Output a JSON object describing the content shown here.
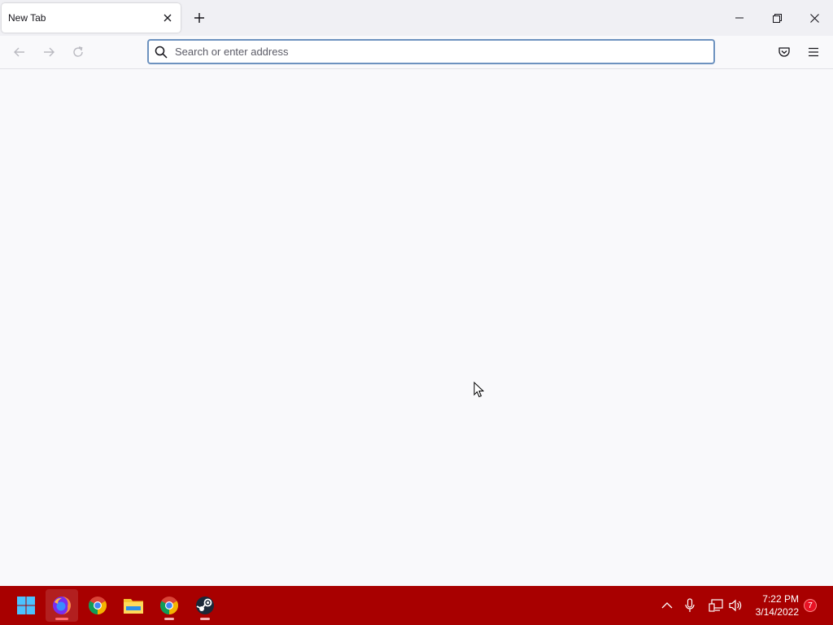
{
  "browser": {
    "tab": {
      "title": "New Tab"
    },
    "urlbar": {
      "placeholder": "Search or enter address",
      "value": ""
    }
  },
  "taskbar": {
    "apps": [
      "windows-start",
      "firefox",
      "chrome",
      "file-explorer",
      "chrome",
      "steam"
    ],
    "accent": "#a80000",
    "clock": {
      "time": "7:22 PM",
      "date": "3/14/2022"
    },
    "notifications": {
      "count": "7"
    }
  },
  "colors": {
    "content_bg": "#f9f9fb",
    "titlebar_bg": "#f0f0f4",
    "urlbar_border": "#6d92bf",
    "taskbar_bg": "#a80000"
  }
}
